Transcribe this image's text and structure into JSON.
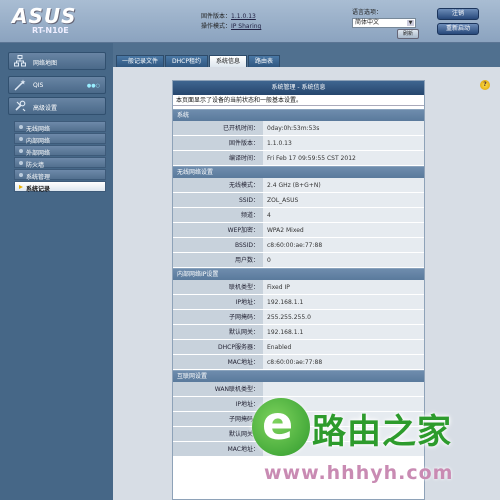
{
  "header": {
    "brand": "ASUS",
    "model": "RT-N10E",
    "firmware_label": "固件版本：",
    "firmware_value": "1.1.0.13",
    "mode_label": "操作模式：",
    "mode_value": "IP Sharing",
    "language_label": "语言选项：",
    "language_value": "简体中文",
    "refresh_label": "刷新",
    "logout_label": "注销",
    "reboot_label": "重新启动"
  },
  "sidebar": {
    "network_map": "网络地图",
    "qis": "QIS",
    "qis_status": "●●○",
    "advanced": "高级设置",
    "items": [
      {
        "label": "无线网络"
      },
      {
        "label": "内部网络"
      },
      {
        "label": "外部网络"
      },
      {
        "label": "防火墙"
      },
      {
        "label": "系统管理"
      },
      {
        "label": "系统记录"
      }
    ]
  },
  "tabs": [
    "一般记录文件",
    "DHCP租约",
    "系统信息",
    "路由表"
  ],
  "active_tab_index": 2,
  "help_label": "?",
  "panel": {
    "title": "系统管理 - 系统信息",
    "description": "本页面显示了设备的当前状态和一般基本设置。",
    "sections": [
      {
        "title": "系统",
        "rows": [
          {
            "key": "已开机时间：",
            "value": "0day:0h:53m:53s"
          },
          {
            "key": "固件版本：",
            "value": "1.1.0.13"
          },
          {
            "key": "编译时间：",
            "value": "Fri Feb 17 09:59:55 CST 2012"
          }
        ]
      },
      {
        "title": "无线网络设置",
        "rows": [
          {
            "key": "无线模式：",
            "value": "2.4 GHz (B+G+N)"
          },
          {
            "key": "SSID：",
            "value": "ZOL_ASUS"
          },
          {
            "key": "频道：",
            "value": "4"
          },
          {
            "key": "WEP加密：",
            "value": "WPA2 Mixed"
          },
          {
            "key": "BSSID：",
            "value": "c8:60:00:ae:77:88"
          },
          {
            "key": "用户数：",
            "value": "0"
          }
        ]
      },
      {
        "title": "内部网络IP设置",
        "rows": [
          {
            "key": "联机类型：",
            "value": "Fixed IP"
          },
          {
            "key": "IP地址：",
            "value": "192.168.1.1"
          },
          {
            "key": "子网掩码：",
            "value": "255.255.255.0"
          },
          {
            "key": "默认网关：",
            "value": "192.168.1.1"
          },
          {
            "key": "DHCP服务器：",
            "value": "Enabled"
          },
          {
            "key": "MAC地址：",
            "value": "c8:60:00:ae:77:88"
          }
        ]
      },
      {
        "title": "互联网设置",
        "rows": [
          {
            "key": "WAN联机类型：",
            "value": ""
          },
          {
            "key": "IP地址：",
            "value": ""
          },
          {
            "key": "子网掩码：",
            "value": ""
          },
          {
            "key": "默认网关：",
            "value": ""
          },
          {
            "key": "MAC地址：",
            "value": ""
          }
        ]
      }
    ]
  },
  "watermark": {
    "logo_letter": "e",
    "name": "路由之家",
    "url": "www.hhhyh.com"
  }
}
